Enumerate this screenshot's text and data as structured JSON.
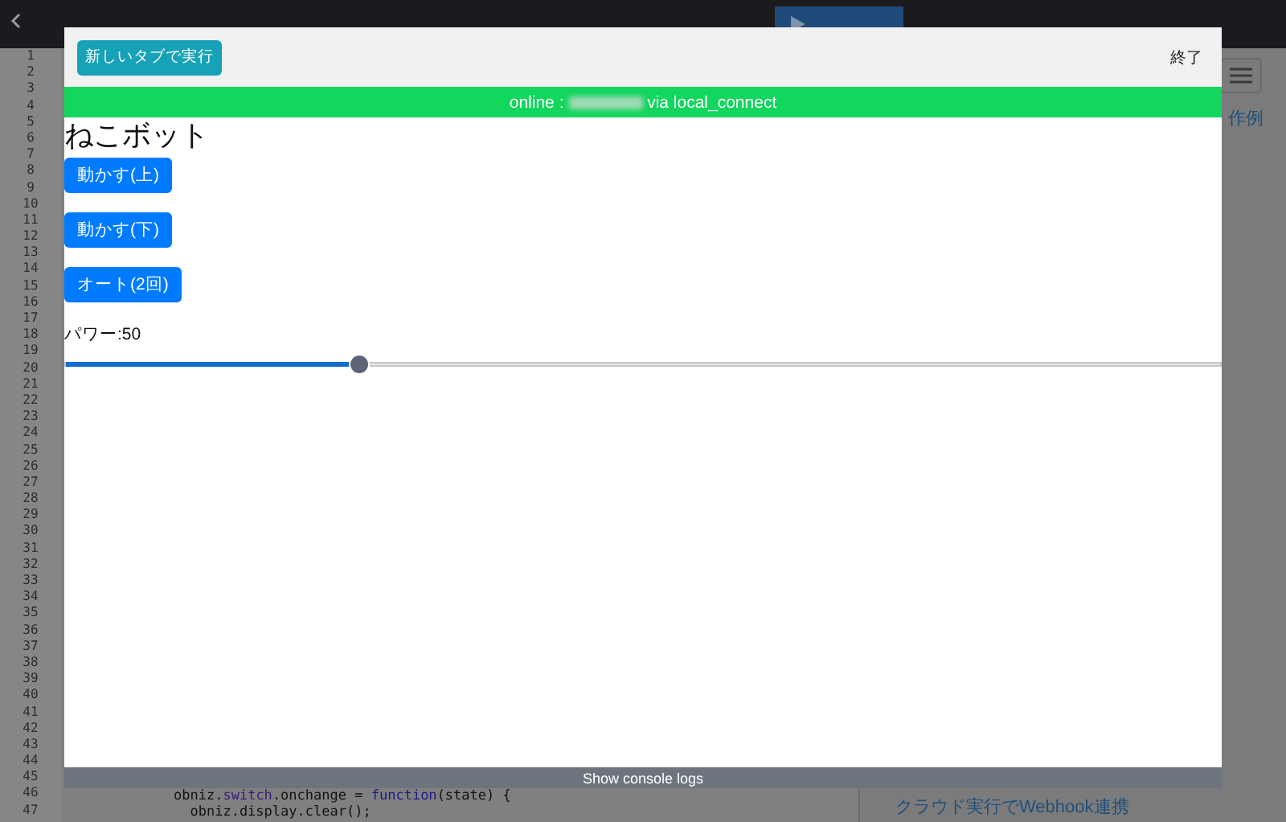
{
  "editor": {
    "line_numbers": [
      "1",
      "2",
      "3",
      "4",
      "5",
      "6",
      "7",
      "8",
      "9",
      "10",
      "11",
      "12",
      "13",
      "14",
      "15",
      "16",
      "17",
      "18",
      "19",
      "20",
      "21",
      "22",
      "23",
      "24",
      "25",
      "26",
      "27",
      "28",
      "29",
      "30",
      "31",
      "32",
      "33",
      "34",
      "35",
      "36",
      "37",
      "38",
      "39",
      "40",
      "41",
      "42",
      "43",
      "44",
      "45",
      "46",
      "47"
    ],
    "code": [
      {
        "parts": [
          {
            "text": "obniz.",
            "kind": "plain"
          },
          {
            "text": "switch",
            "kind": "prop"
          },
          {
            "text": ".onchange = ",
            "kind": "plain"
          },
          {
            "text": "function",
            "kind": "keyword"
          },
          {
            "text": "(state) {",
            "kind": "plain"
          }
        ]
      },
      {
        "parts": [
          {
            "text": "  obniz.display.clear();",
            "kind": "plain"
          }
        ]
      }
    ]
  },
  "side_panel": {
    "examples_link": "作例",
    "webhook_link": "クラウド実行でWebhook連携"
  },
  "modal": {
    "open_tab_button": "新しいタブで実行",
    "close_button": "終了",
    "status": {
      "prefix": "online : ",
      "suffix": " via local_connect"
    },
    "title": "ねこボット",
    "buttons": [
      "動かす(上)",
      "動かす(下)",
      "オート(2回)"
    ],
    "power_label": "パワー:50",
    "slider": {
      "level": 0.253
    },
    "console_toggle": "Show console logs"
  }
}
